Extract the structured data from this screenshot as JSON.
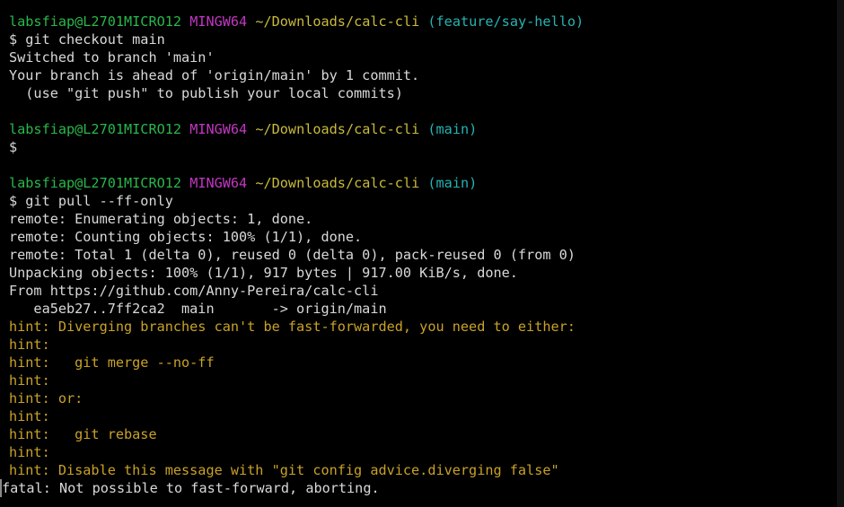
{
  "prompts": [
    {
      "user": "labsfiap@L2701MICRO12",
      "system": "MINGW64",
      "path": "~/Downloads/calc-cli",
      "branch": "(feature/say-hello)"
    },
    {
      "user": "labsfiap@L2701MICRO12",
      "system": "MINGW64",
      "path": "~/Downloads/calc-cli",
      "branch": "(main)"
    },
    {
      "user": "labsfiap@L2701MICRO12",
      "system": "MINGW64",
      "path": "~/Downloads/calc-cli",
      "branch": "(main)"
    }
  ],
  "commands": {
    "checkout": "$ git checkout main",
    "empty": "$",
    "pull": "$ git pull --ff-only"
  },
  "checkout_output": [
    "Switched to branch 'main'",
    "Your branch is ahead of 'origin/main' by 1 commit.",
    "  (use \"git push\" to publish your local commits)"
  ],
  "pull_output": [
    "remote: Enumerating objects: 1, done.",
    "remote: Counting objects: 100% (1/1), done.",
    "remote: Total 1 (delta 0), reused 0 (delta 0), pack-reused 0 (from 0)",
    "Unpacking objects: 100% (1/1), 917 bytes | 917.00 KiB/s, done.",
    "From https://github.com/Anny-Pereira/calc-cli",
    "   ea5eb27..7ff2ca2  main       -> origin/main"
  ],
  "hints": [
    "hint: Diverging branches can't be fast-forwarded, you need to either:",
    "hint:",
    "hint:   git merge --no-ff",
    "hint:",
    "hint: or:",
    "hint:",
    "hint:   git rebase",
    "hint:",
    "hint: Disable this message with \"git config advice.diverging false\""
  ],
  "fatal": "fatal: Not possible to fast-forward, aborting."
}
